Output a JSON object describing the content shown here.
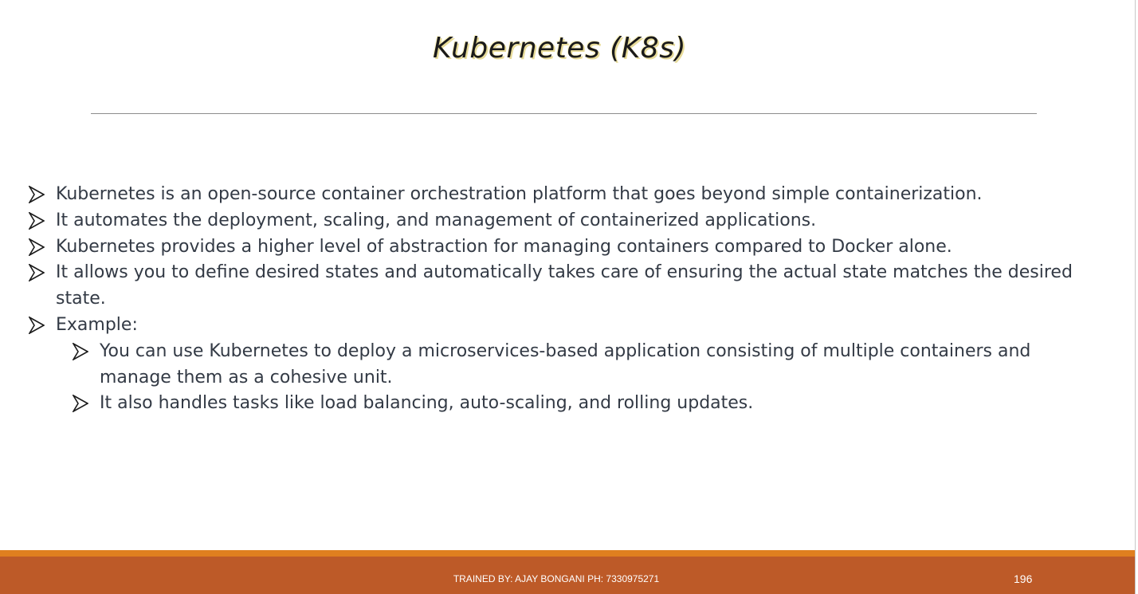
{
  "slide": {
    "title": "Kubernetes (K8s)",
    "bullets": [
      "Kubernetes is an open-source container orchestration platform that goes beyond simple containerization.",
      "It automates the deployment, scaling, and management of containerized applications.",
      "Kubernetes provides a higher level of abstraction for managing containers compared to Docker alone.",
      "It allows you to define desired states and automatically takes care of ensuring the actual state matches the desired state.",
      "Example:"
    ],
    "sub_bullets": [
      "You can use Kubernetes to deploy a microservices-based application consisting of multiple containers and manage them as a cohesive unit.",
      "It also handles tasks like load balancing, auto-scaling, and rolling updates."
    ],
    "bullet_icon": "arrowhead-bullet-icon"
  },
  "footer": {
    "trainer_text": "TRAINED BY: AJAY BONGANI PH: 7330975271",
    "page_number": "196"
  },
  "colors": {
    "footer_band": "#bd5a28",
    "footer_accent": "#e07f1f",
    "body_text": "#333a45"
  }
}
